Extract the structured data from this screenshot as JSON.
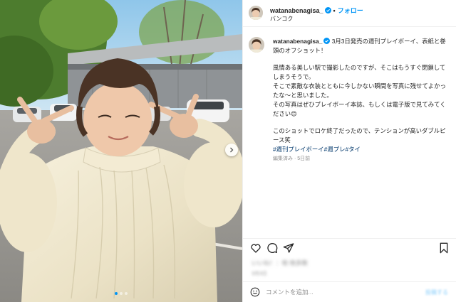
{
  "post": {
    "header": {
      "username": "watanabenagisa_",
      "separator": "•",
      "follow_label": "フォロー",
      "location": "バンコク"
    },
    "caption": {
      "username": "watanabenagisa_",
      "line1": "3月3日発売の週刊プレイボーイ、表紙と巻頭のオフショット！",
      "para2": "風情ある美しい駅で撮影したのですが、そこはもうすぐ閉鎖してしまうそうで。",
      "para3": "そこで素敵な衣装とともに今しかない瞬間を写真に残せてよかったな〜と思いました。",
      "para4": "その写真はぜひプレイボーイ本誌、もしくは電子版で見てみてください",
      "para4_emoji": "😊",
      "para5": "このショットでロケ終了だったので、テンションが高いダブルピース笑",
      "hashtags": "#週刊プレイボーイ#週プレ#タイ",
      "meta": "編集済み · 5日前"
    },
    "likes_text": "いいね！：他 他多数",
    "date_text": "3月3日",
    "comment": {
      "placeholder": "コメントを追加...",
      "post_label": "投稿する"
    }
  },
  "icons": {
    "verified": "verified-badge-icon",
    "like": "heart-icon",
    "comment": "comment-icon",
    "share": "send-icon",
    "save": "bookmark-icon",
    "emoji": "smiley-icon",
    "next": "chevron-right-icon"
  },
  "colors": {
    "link_blue": "#0095f6",
    "hashtag": "#00376b",
    "muted": "#8e8e8e",
    "border": "#efefef"
  },
  "carousel": {
    "count": 3,
    "active": 1
  }
}
